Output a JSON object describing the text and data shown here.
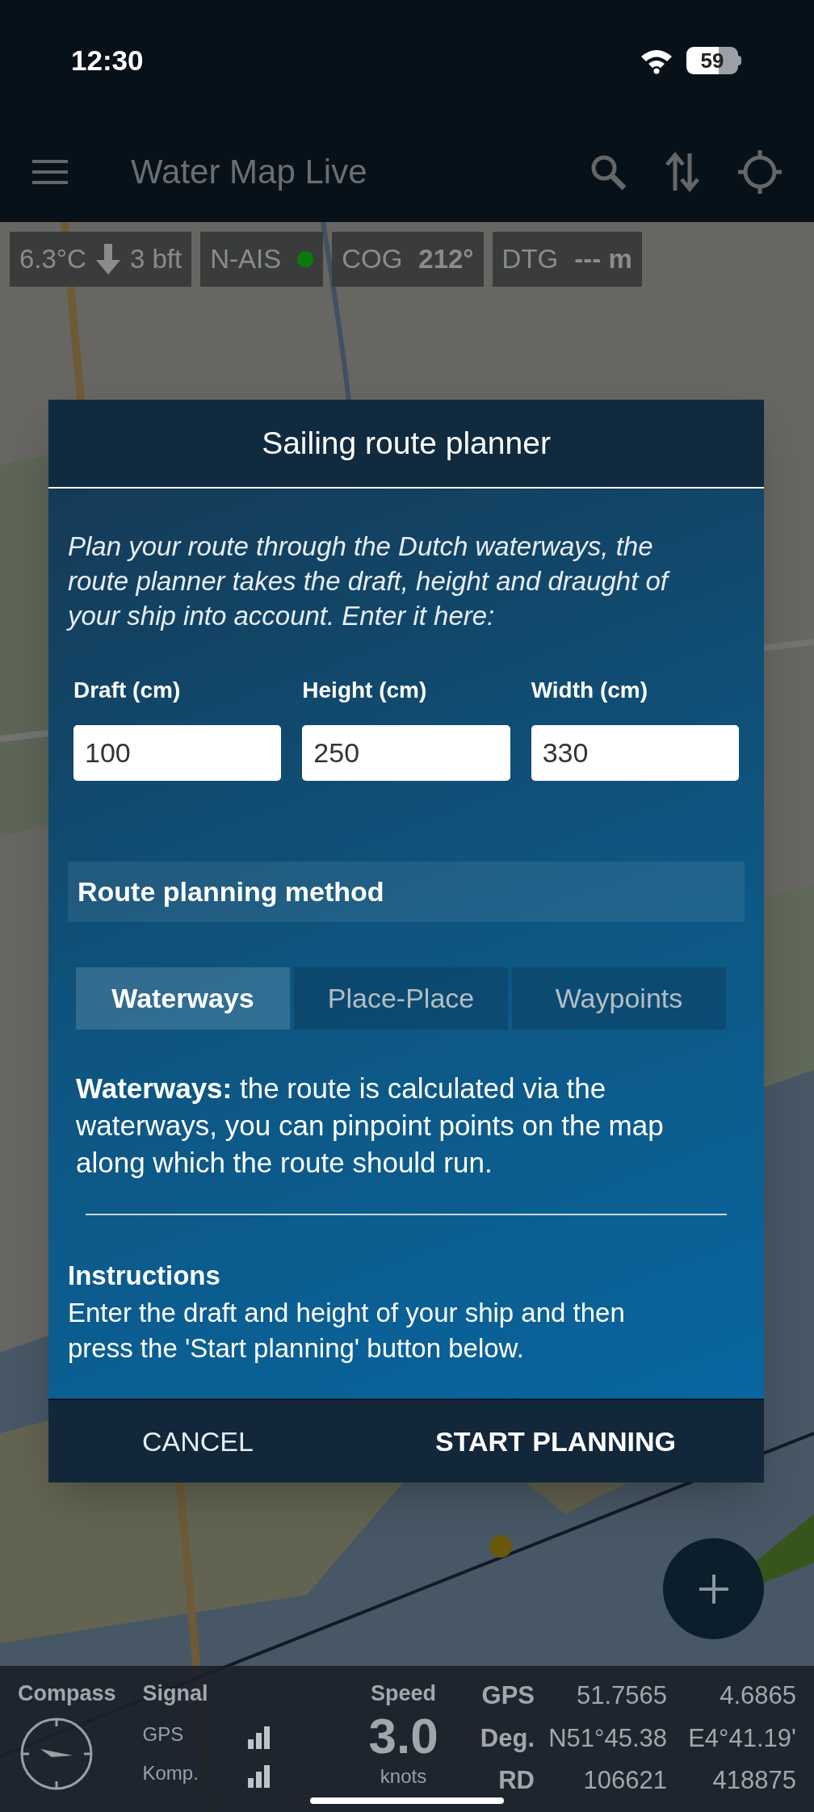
{
  "status_bar": {
    "time": "12:30",
    "battery": "59"
  },
  "app_bar": {
    "title": "Water Map Live"
  },
  "info_chips": [
    {
      "kind": "weather",
      "temperature": "6.3°C",
      "wind": "3 bft"
    },
    {
      "kind": "status",
      "label": "N-AIS",
      "color": "#0a7a0a"
    },
    {
      "kind": "value",
      "label": "COG",
      "value": "212°"
    },
    {
      "kind": "value",
      "label": "DTG",
      "value": "--- m"
    }
  ],
  "dialog": {
    "title": "Sailing route planner",
    "intro": "Plan your route through the Dutch waterways, the route planner takes the draft, height and draught of your ship into account. Enter it here:",
    "fields": [
      {
        "label": "Draft (cm)",
        "value": "100"
      },
      {
        "label": "Height (cm)",
        "value": "250"
      },
      {
        "label": "Width (cm)",
        "value": "330"
      }
    ],
    "method_heading": "Route planning method",
    "tabs": [
      {
        "label": "Waterways",
        "selected": true
      },
      {
        "label": "Place-Place",
        "selected": false
      },
      {
        "label": "Waypoints",
        "selected": false
      }
    ],
    "description": "**Waterways:** the route is calculated via the waterways, you can pinpoint points on the map along which the route should run.",
    "instructions_title": "Instructions",
    "instructions_text": "Enter the draft and height of your ship and then press the 'Start planning' button below.",
    "buttons": [
      {
        "label": "CANCEL",
        "kind": "secondary"
      },
      {
        "label": "START PLANNING",
        "kind": "primary"
      }
    ]
  },
  "bottom_panel": {
    "compass_label": "Compass",
    "signal_label": "Signal",
    "signal_rows": [
      "GPS",
      "Komp."
    ],
    "speed_label": "Speed",
    "speed_value": "3.0",
    "speed_unit": "knots",
    "positions": [
      {
        "label": "GPS",
        "values": [
          "51.7565",
          "4.6865"
        ]
      },
      {
        "label": "Deg.",
        "values": [
          "N51°45.38",
          "E4°41.19'"
        ]
      },
      {
        "label": "RD",
        "values": [
          "106621",
          "418875"
        ]
      }
    ]
  }
}
